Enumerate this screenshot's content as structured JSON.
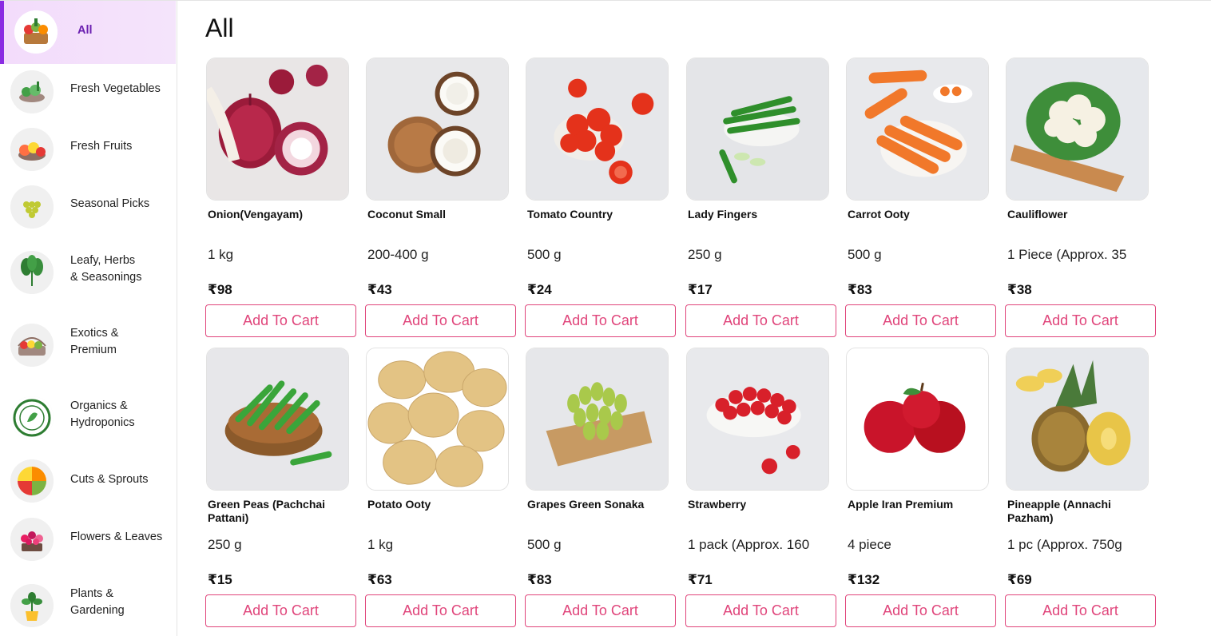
{
  "page": {
    "title": "All"
  },
  "categories": [
    {
      "label": "All",
      "icon": "basket-icon",
      "active": true
    },
    {
      "label": "Fresh Vegetables",
      "icon": "vegetables-icon"
    },
    {
      "label": "Fresh Fruits",
      "icon": "fruits-icon"
    },
    {
      "label": "Seasonal Picks",
      "icon": "grapes-icon"
    },
    {
      "label": "Leafy, Herbs\n& Seasonings",
      "icon": "spinach-icon"
    },
    {
      "label": "Exotics &\nPremium",
      "icon": "exotic-basket-icon"
    },
    {
      "label": "Organics &\nHydroponics",
      "icon": "organic-badge-icon"
    },
    {
      "label": "Cuts & Sprouts",
      "icon": "cut-fruit-bowl-icon"
    },
    {
      "label": "Flowers & Leaves",
      "icon": "flowers-icon"
    },
    {
      "label": "Plants &\nGardening",
      "icon": "potted-plant-icon"
    }
  ],
  "products": [
    {
      "name": "Onion(Vengayam)",
      "qty": "1 kg",
      "price": "₹98",
      "button": "Add To Cart",
      "icon": "onion-icon"
    },
    {
      "name": "Coconut Small",
      "qty": "200-400 g",
      "price": "₹43",
      "button": "Add To Cart",
      "icon": "coconut-icon"
    },
    {
      "name": "Tomato Country",
      "qty": "500 g",
      "price": "₹24",
      "button": "Add To Cart",
      "icon": "tomato-icon"
    },
    {
      "name": "Lady Fingers",
      "qty": "250 g",
      "price": "₹17",
      "button": "Add To Cart",
      "icon": "okra-icon"
    },
    {
      "name": "Carrot Ooty",
      "qty": "500 g",
      "price": "₹83",
      "button": "Add To Cart",
      "icon": "carrot-icon"
    },
    {
      "name": "Cauliflower",
      "qty": "1 Piece (Approx. 35",
      "price": "₹38",
      "button": "Add To Cart",
      "icon": "cauliflower-icon"
    },
    {
      "name": "Green Peas (Pachchai Pattani)",
      "qty": "250 g",
      "price": "₹15",
      "button": "Add To Cart",
      "icon": "peas-icon"
    },
    {
      "name": "Potato Ooty",
      "qty": "1 kg",
      "price": "₹63",
      "button": "Add To Cart",
      "icon": "potato-icon"
    },
    {
      "name": "Grapes Green Sonaka",
      "qty": "500 g",
      "price": "₹83",
      "button": "Add To Cart",
      "icon": "grapes-icon"
    },
    {
      "name": "Strawberry",
      "qty": "1 pack (Approx. 160",
      "price": "₹71",
      "button": "Add To Cart",
      "icon": "strawberry-icon"
    },
    {
      "name": "Apple Iran Premium",
      "qty": "4 piece",
      "price": "₹132",
      "button": "Add To Cart",
      "icon": "apple-icon"
    },
    {
      "name": "Pineapple (Annachi Pazham)",
      "qty": "1 pc (Approx. 750g",
      "price": "₹69",
      "button": "Add To Cart",
      "icon": "pineapple-icon"
    }
  ],
  "colors": {
    "accent": "#e0457b",
    "active_bar": "#8a2be2",
    "active_bg": "#f3dcfb"
  }
}
